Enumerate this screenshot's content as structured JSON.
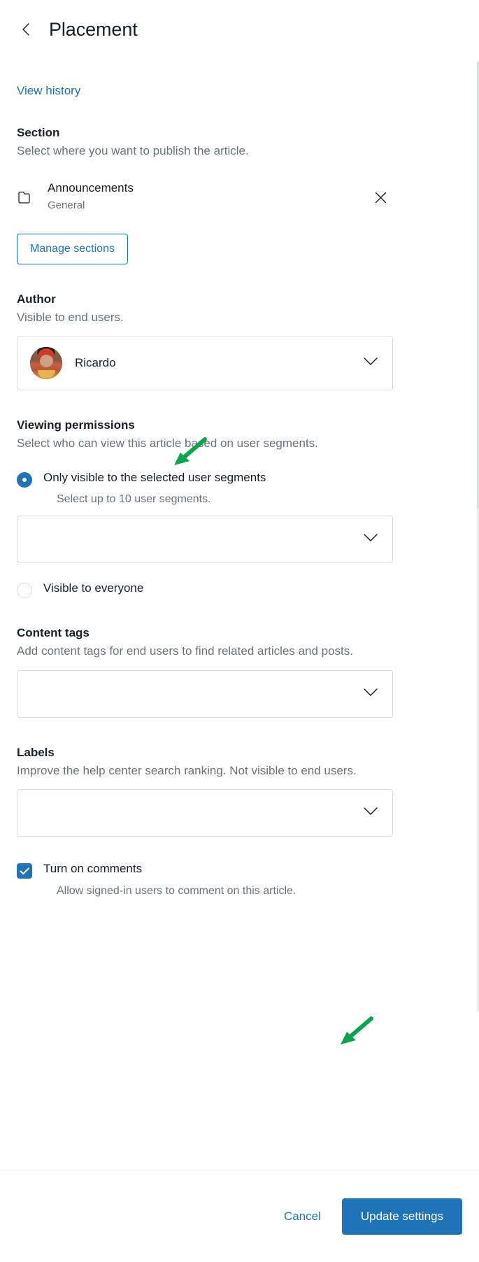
{
  "header": {
    "back_icon": "chevron-left-icon",
    "title": "Placement"
  },
  "history_link": "View history",
  "section": {
    "title": "Section",
    "description": "Select where you want to publish the article.",
    "folder_icon": "folder-icon",
    "selected_name": "Announcements",
    "selected_parent": "General",
    "remove_icon": "close-icon",
    "manage_button": "Manage sections"
  },
  "author": {
    "title": "Author",
    "description": "Visible to end users.",
    "selected": "Ricardo",
    "chevron_icon": "chevron-down-icon",
    "avatar_icon": "avatar"
  },
  "viewing_permissions": {
    "title": "Viewing permissions",
    "description": "Select who can view this article based on user segments.",
    "option_selected": {
      "label": "Only visible to the selected user segments",
      "hint": "Select up to 10 user segments.",
      "checked": true
    },
    "segments_select_value": "",
    "option_everyone": {
      "label": "Visible to everyone",
      "checked": false
    }
  },
  "content_tags": {
    "title": "Content tags",
    "description": "Add content tags for end users to find related articles and posts.",
    "value": ""
  },
  "labels": {
    "title": "Labels",
    "description": "Improve the help center search ranking. Not visible to end users.",
    "value": ""
  },
  "comments": {
    "label": "Turn on comments",
    "hint": "Allow signed-in users to comment on this article.",
    "checked": true,
    "check_icon": "checkmark-icon"
  },
  "footer": {
    "cancel": "Cancel",
    "submit": "Update settings"
  },
  "annotations": {
    "arrow_permissions": "green-arrow-icon",
    "arrow_update": "green-arrow-icon"
  },
  "colors": {
    "accent_blue": "#1f73b7",
    "text_primary": "#16202c",
    "text_secondary": "#68737d",
    "border": "#d8dcde",
    "annotation_green": "#09a54c"
  }
}
